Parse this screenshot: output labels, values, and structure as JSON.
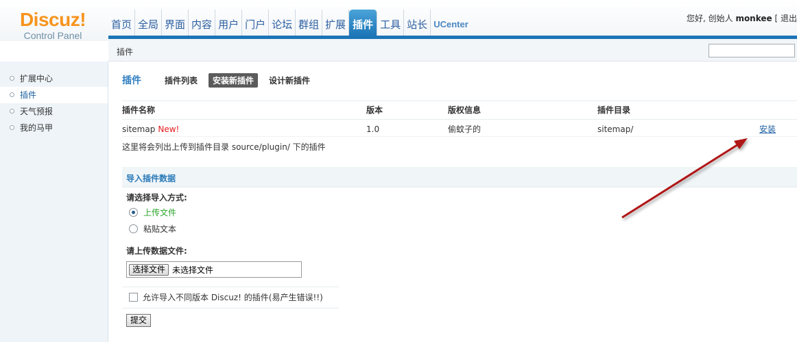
{
  "logo": {
    "main": "Discuz!",
    "sub": "Control Panel"
  },
  "nav": {
    "items": [
      {
        "label": "首页"
      },
      {
        "label": "全局"
      },
      {
        "label": "界面"
      },
      {
        "label": "内容"
      },
      {
        "label": "用户"
      },
      {
        "label": "门户"
      },
      {
        "label": "论坛"
      },
      {
        "label": "群组"
      },
      {
        "label": "扩展"
      },
      {
        "label": "插件",
        "active": true
      },
      {
        "label": "工具"
      },
      {
        "label": "站长"
      },
      {
        "label": "UCenter"
      }
    ]
  },
  "user": {
    "greeting": "您好, 创始人",
    "name": "monkee",
    "extra": "[ 退出"
  },
  "subbar": {
    "title": "插件",
    "search_value": ""
  },
  "sidebar": {
    "items": [
      {
        "label": "扩展中心"
      },
      {
        "label": "插件",
        "active": true
      },
      {
        "label": "天气预报"
      },
      {
        "label": "我的马甲"
      }
    ]
  },
  "tabs": {
    "heading": "插件",
    "items": [
      {
        "label": "插件列表"
      },
      {
        "label": "安装新插件",
        "active": true
      },
      {
        "label": "设计新插件"
      }
    ]
  },
  "table": {
    "headers": [
      "插件名称",
      "版本",
      "版权信息",
      "插件目录"
    ],
    "rows": [
      {
        "name": "sitemap",
        "badge": "New!",
        "version": "1.0",
        "copyright": "偷蚊子的",
        "dir": "sitemap/",
        "action": "安装"
      }
    ],
    "note": "这里将会列出上传到插件目录 source/plugin/ 下的插件"
  },
  "import": {
    "section_title": "导入插件数据",
    "method_label": "请选择导入方式:",
    "options": [
      {
        "label": "上传文件",
        "selected": true
      },
      {
        "label": "粘贴文本",
        "selected": false
      }
    ],
    "file_label": "请上传数据文件:",
    "file_button": "选择文件",
    "file_status": "未选择文件",
    "allow_checkbox_label": "允许导入不同版本 Discuz! 的插件(易产生错误!!)",
    "allow_checked": false,
    "submit": "提交"
  },
  "colors": {
    "brand_orange": "#f7941d",
    "nav_active": "#1b74b5",
    "link_blue": "#1b5ea0",
    "new_red": "#e31b1b",
    "green_option": "#2aa52a",
    "arrow_red": "#b01212"
  }
}
